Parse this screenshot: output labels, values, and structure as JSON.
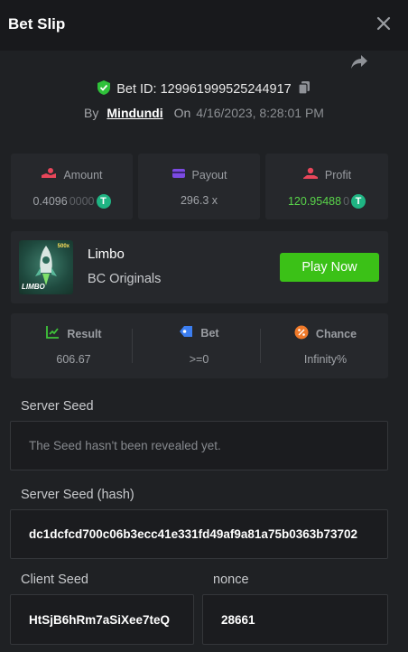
{
  "header": {
    "title": "Bet Slip",
    "close_icon": "close-icon"
  },
  "bet": {
    "id_text": "Bet ID: 129961999525244917",
    "by_label": "By",
    "user": "Mindundi",
    "on_label": "On",
    "datetime": "4/16/2023, 8:28:01 PM"
  },
  "stats": {
    "amount": {
      "label": "Amount",
      "value_main": "0.4096",
      "value_dim": "0000",
      "coin": "T"
    },
    "payout": {
      "label": "Payout",
      "value": "296.3 x"
    },
    "profit": {
      "label": "Profit",
      "value_main": "120.95488",
      "value_dim": "0",
      "coin": "T"
    }
  },
  "game": {
    "name": "Limbo",
    "provider": "BC Originals",
    "play_label": "Play Now",
    "thumb_text": "LIMBO",
    "thumb_badge": "500x"
  },
  "results": {
    "result": {
      "label": "Result",
      "value": "606.67"
    },
    "bet": {
      "label": "Bet",
      "value": ">=0"
    },
    "chance": {
      "label": "Chance",
      "value": "Infinity%"
    }
  },
  "seeds": {
    "server_seed_label": "Server Seed",
    "server_seed_value": "The Seed hasn't been revealed yet.",
    "server_hash_label": "Server Seed (hash)",
    "server_hash_value": "dc1dcfcd700c06b3ecc41e331fd49af9a81a75b0363b73702",
    "client_seed_label": "Client Seed",
    "client_seed_value": "HtSjB6hRm7aSiXee7teQ",
    "nonce_label": "nonce",
    "nonce_value": "28661"
  },
  "colors": {
    "accent_green": "#3bc117",
    "profit_green": "#59d44a",
    "coin": "#1fb483",
    "amount_red": "#e8465a",
    "payout_purple": "#7b4ae2",
    "bet_blue": "#3c7ef0",
    "chance_orange": "#f07a2a"
  }
}
